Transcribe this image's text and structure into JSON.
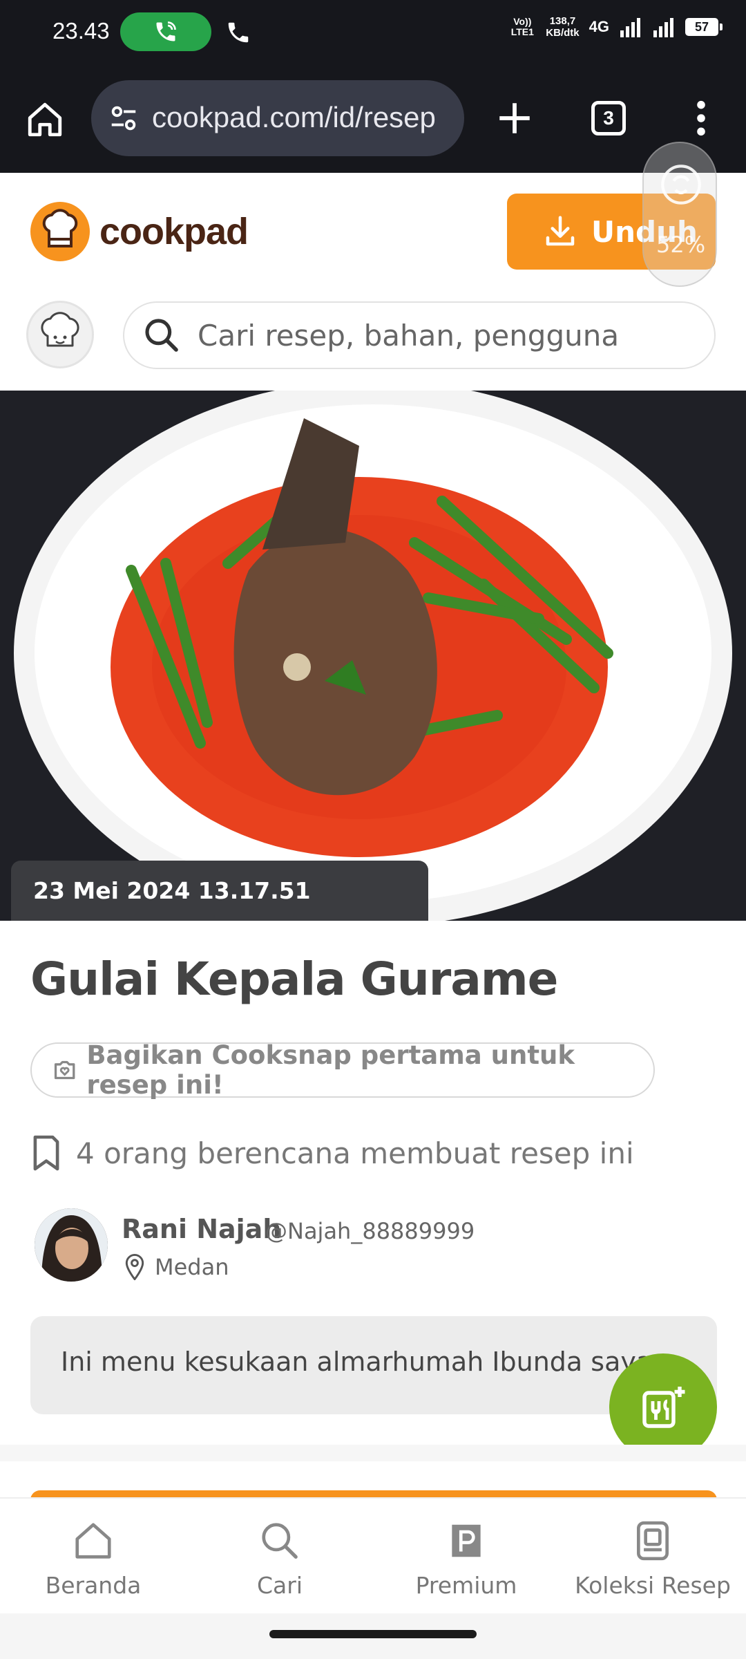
{
  "status_bar": {
    "time": "23.43",
    "volte": "Vo)) LTE1",
    "speed_top": "138,7",
    "speed_bottom": "KB/dtk",
    "network": "4G",
    "battery": "57"
  },
  "browser": {
    "url": "cookpad.com/id/resep",
    "tab_count": "3"
  },
  "header": {
    "brand": "cookpad",
    "download_label": "Unduh",
    "overlay_percent": "52%",
    "search_placeholder": "Cari resep, bahan, pengguna"
  },
  "recipe": {
    "date": "23 Mei 2024 13.17.51",
    "title": "Gulai Kepala Gurame",
    "cooksnap_label": "Bagikan Cooksnap pertama untuk resep ini!",
    "plans_text": "4 orang berencana membuat resep ini",
    "author_name": "Rani Najah",
    "author_handle": "@Najah_88889999",
    "author_location": "Medan",
    "story": "Ini menu kesukaan almarhumah Ibunda saya."
  },
  "bottom_nav": {
    "items": [
      {
        "label": "Beranda",
        "icon": "home-icon"
      },
      {
        "label": "Cari",
        "icon": "search-icon"
      },
      {
        "label": "Premium",
        "icon": "premium-icon"
      },
      {
        "label": "Koleksi Resep",
        "icon": "recipe-collection-icon"
      }
    ]
  },
  "colors": {
    "accent": "#f7931e",
    "fab": "#7bb321",
    "status_bg": "#16171c"
  }
}
